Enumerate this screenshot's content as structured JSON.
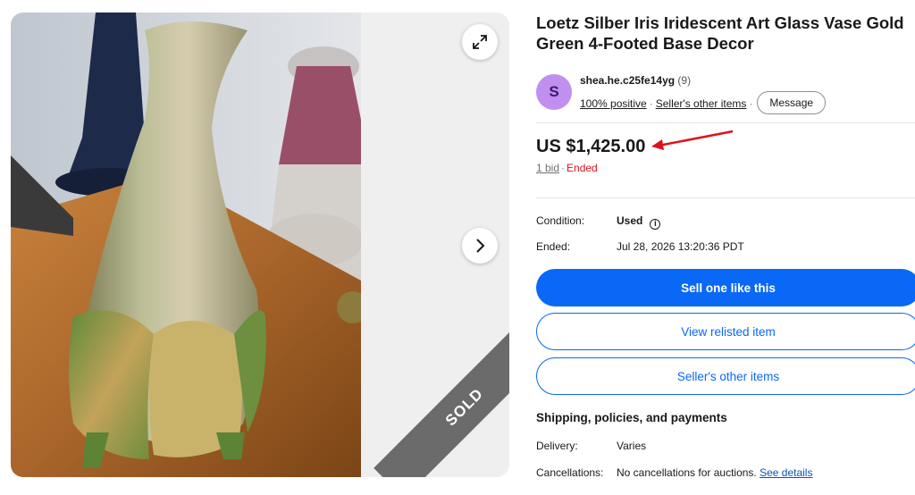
{
  "listing": {
    "title": "Loetz Silber Iris Iridescent Art Glass Vase Gold Green 4-Footed Base Decor",
    "sold_label": "SOLD"
  },
  "seller": {
    "avatar_initial": "S",
    "username": "shea.he.c25fe14yg",
    "feedback_count": "(9)",
    "positive": "100% positive",
    "other_items_link": "Seller's other items",
    "message_button": "Message"
  },
  "price": {
    "amount": "US $1,425.00",
    "bids": "1 bid",
    "status": "Ended"
  },
  "details": {
    "condition_label": "Condition:",
    "condition_value": "Used",
    "ended_label": "Ended:",
    "ended_value": "Jul 28, 2026 13:20:36 PDT"
  },
  "actions": {
    "sell_one": "Sell one like this",
    "view_relisted": "View relisted item",
    "sellers_other_items": "Seller's other items"
  },
  "shipping": {
    "section_title": "Shipping, policies, and payments",
    "delivery_label": "Delivery:",
    "delivery_value": "Varies",
    "cancellations_label": "Cancellations:",
    "cancellations_value": "No cancellations for auctions.",
    "see_details": "See details"
  },
  "icons": {
    "expand": "expand-icon",
    "next": "chevron-right-icon",
    "info": "info-icon"
  },
  "colors": {
    "primary_blue": "#0968f6",
    "ended_red": "#e0111b",
    "avatar_purple": "#c08ff0",
    "arrow_red": "#e0111b"
  }
}
